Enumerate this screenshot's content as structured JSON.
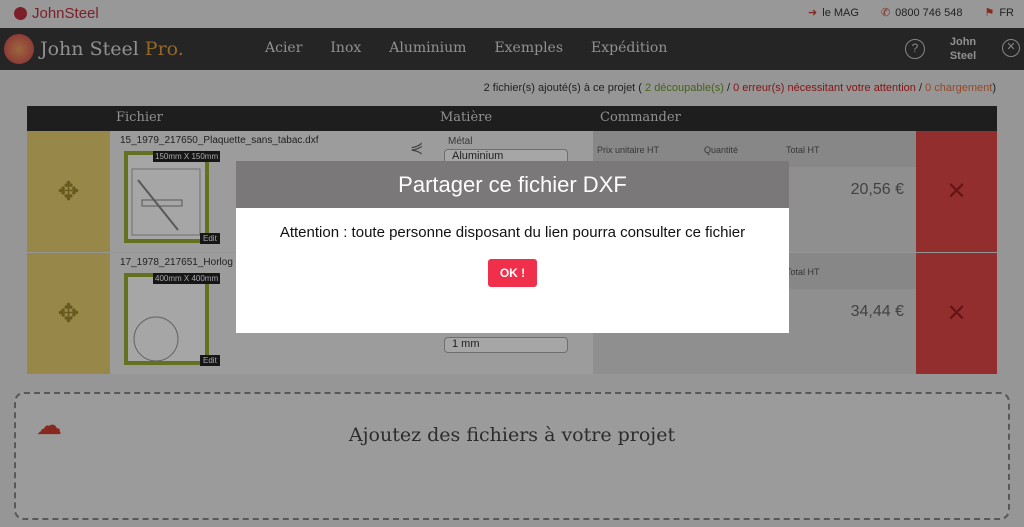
{
  "topbar": {
    "logo": "JohnSteel",
    "mag": "le MAG",
    "phone": "0800 746 548",
    "lang": "FR"
  },
  "nav": {
    "brand": "John Steel ",
    "brand_pro": "Pro.",
    "items": [
      "Acier",
      "Inox",
      "Aluminium",
      "Exemples",
      "Expédition"
    ],
    "help": "?",
    "user": "John Steel"
  },
  "status": {
    "prefix": "2 fichier(s) ajouté(s) à ce projet ( ",
    "ok": "2 découpable(s)",
    "sep1": " / ",
    "errors": "0 erreur(s) nécessitant votre attention",
    "sep2": " / ",
    "loading": "0 chargement",
    "suffix": ")"
  },
  "table": {
    "headers": [
      "Fichier",
      "Matière",
      "Commander"
    ],
    "rows": [
      {
        "file": "15_1979_217650_Plaquette_sans_tabac.dxf",
        "dims": "150mm X 150mm",
        "edit": "Edit",
        "material_label": "Métal",
        "material": "Aluminium",
        "price_label": "Prix unitaire HT",
        "qty_label": "Quantité",
        "total_label": "Total HT",
        "total": "20,56 €"
      },
      {
        "file": "17_1978_217651_Horlog",
        "dims": "400mm X 400mm",
        "edit": "Edit",
        "thickness": "1 mm",
        "total_label": "Total HT",
        "total": "34,44 €"
      }
    ]
  },
  "dropzone": {
    "text": "Ajoutez des fichiers à votre projet"
  },
  "modal": {
    "title": "Partager ce fichier DXF",
    "message": "Attention : toute personne disposant du lien pourra consulter ce fichier",
    "ok": "OK !"
  }
}
